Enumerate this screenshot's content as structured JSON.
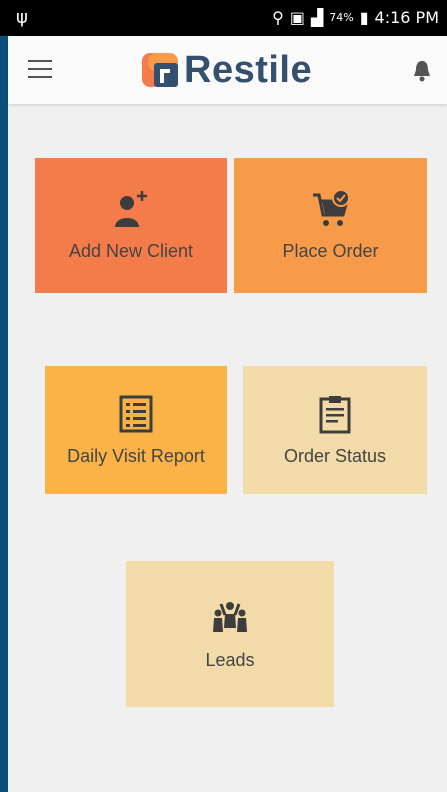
{
  "status_bar": {
    "usb_icon": "usb-icon",
    "battery": "74%",
    "time": "4:16 PM"
  },
  "app_bar": {
    "brand": "Restile",
    "menu_icon": "hamburger-icon",
    "notification_icon": "bell-icon"
  },
  "tiles": [
    {
      "label": "Add New Client",
      "icon": "add-person-icon",
      "color": "#f47c4b"
    },
    {
      "label": "Place Order",
      "icon": "cart-check-icon",
      "color": "#f79b4b"
    },
    {
      "label": "Daily Visit Report",
      "icon": "checklist-icon",
      "color": "#fbb347"
    },
    {
      "label": "Order Status",
      "icon": "clipboard-icon",
      "color": "#f2dba8"
    },
    {
      "label": "Leads",
      "icon": "people-group-icon",
      "color": "#f2dba8"
    }
  ]
}
